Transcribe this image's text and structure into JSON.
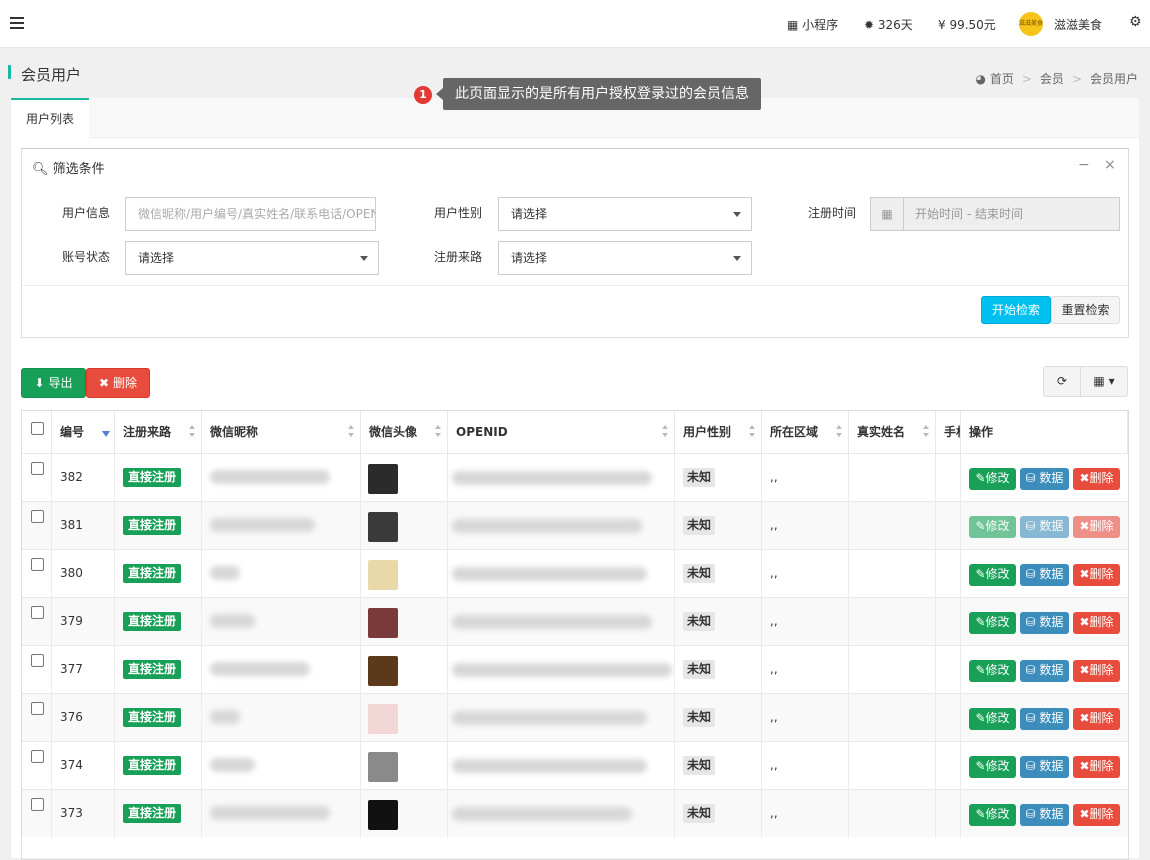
{
  "topbar": {
    "mini_program": "小程序",
    "days": "326天",
    "balance": "¥ 99.50元",
    "avatar_text": "滋滋美食",
    "shop_name": "滋滋美食"
  },
  "page": {
    "title": "会员用户",
    "breadcrumb": [
      "首页",
      "会员",
      "会员用户"
    ]
  },
  "tooltip": {
    "number": "1",
    "text": "此页面显示的是所有用户授权登录过的会员信息"
  },
  "tabs": [
    "用户列表"
  ],
  "filter": {
    "title": "筛选条件",
    "user_info_label": "用户信息",
    "user_info_placeholder": "微信昵称/用户编号/真实姓名/联系电话/OPENID",
    "gender_label": "用户性别",
    "gender_value": "请选择",
    "reg_time_label": "注册时间",
    "reg_time_placeholder": "开始时间 - 结束时间",
    "status_label": "账号状态",
    "status_value": "请选择",
    "source_label": "注册来路",
    "source_value": "请选择",
    "search_button": "开始检索",
    "reset_button": "重置检索"
  },
  "toolbar": {
    "export": "导出",
    "delete": "删除"
  },
  "table": {
    "columns": [
      "编号",
      "注册来路",
      "微信昵称",
      "微信头像",
      "OPENID",
      "用户性别",
      "所在区域",
      "真实姓名",
      "手机",
      "操作"
    ],
    "rows": [
      {
        "id": "382",
        "source": "直接注册",
        "gender": "未知",
        "region": ",,",
        "avatar_color": "#2b2b2b"
      },
      {
        "id": "381",
        "source": "直接注册",
        "gender": "未知",
        "region": ",,",
        "avatar_color": "#3a3a3a"
      },
      {
        "id": "380",
        "source": "直接注册",
        "gender": "未知",
        "region": ",,",
        "avatar_color": "#e9d9a8"
      },
      {
        "id": "379",
        "source": "直接注册",
        "gender": "未知",
        "region": ",,",
        "avatar_color": "#7a3a3a"
      },
      {
        "id": "377",
        "source": "直接注册",
        "gender": "未知",
        "region": ",,",
        "avatar_color": "#5a3a1a"
      },
      {
        "id": "376",
        "source": "直接注册",
        "gender": "未知",
        "region": ",,",
        "avatar_color": "#f3d6d6"
      },
      {
        "id": "374",
        "source": "直接注册",
        "gender": "未知",
        "region": ",,",
        "avatar_color": "#8a8a8a"
      },
      {
        "id": "373",
        "source": "直接注册",
        "gender": "未知",
        "region": ",,",
        "avatar_color": "#111111"
      }
    ],
    "actions": {
      "edit": "修改",
      "data": "数据",
      "delete": "删除"
    }
  }
}
